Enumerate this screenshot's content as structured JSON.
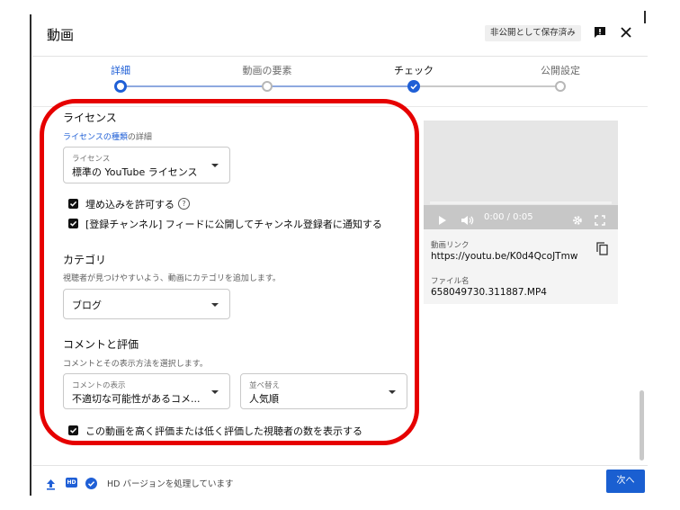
{
  "header": {
    "title": "動画",
    "saved_badge": "非公開として保存済み"
  },
  "steps": [
    {
      "label": "詳細",
      "state": "current"
    },
    {
      "label": "動画の要素",
      "state": "upcoming"
    },
    {
      "label": "チェック",
      "state": "done"
    },
    {
      "label": "公開設定",
      "state": "upcoming"
    }
  ],
  "license": {
    "title": "ライセンス",
    "details_link": "ライセンスの種類",
    "details_suffix": "の詳細",
    "select_label": "ライセンス",
    "select_value": "標準の YouTube ライセンス",
    "allow_embed": {
      "label": "埋め込みを許可する",
      "checked": true
    },
    "notify_subscribers": {
      "label": "[登録チャンネル] フィードに公開してチャンネル登録者に通知する",
      "checked": true
    }
  },
  "category": {
    "title": "カテゴリ",
    "description": "視聴者が見つけやすいよう、動画にカテゴリを追加します。",
    "value": "ブログ"
  },
  "comments": {
    "title": "コメントと評価",
    "description": "コメントとその表示方法を選択します。",
    "visibility_label": "コメントの表示",
    "visibility_value": "不適切な可能性があるコメ...",
    "sort_label": "並べ替え",
    "sort_value": "人気順",
    "show_ratings": {
      "label": "この動画を高く評価または低く評価した視聴者の数を表示する",
      "checked": true
    }
  },
  "video": {
    "time": "0:00 / 0:05",
    "link_label": "動画リンク",
    "link_url": "https://youtu.be/K0d4QcoJTmw",
    "filename_label": "ファイル名",
    "filename": "658049730.311887.MP4"
  },
  "footer": {
    "status": "HD バージョンを処理しています",
    "hd": "HD",
    "next_label": "次へ"
  },
  "colors": {
    "accent": "#1f5fd6",
    "annotation": "#e60000"
  }
}
